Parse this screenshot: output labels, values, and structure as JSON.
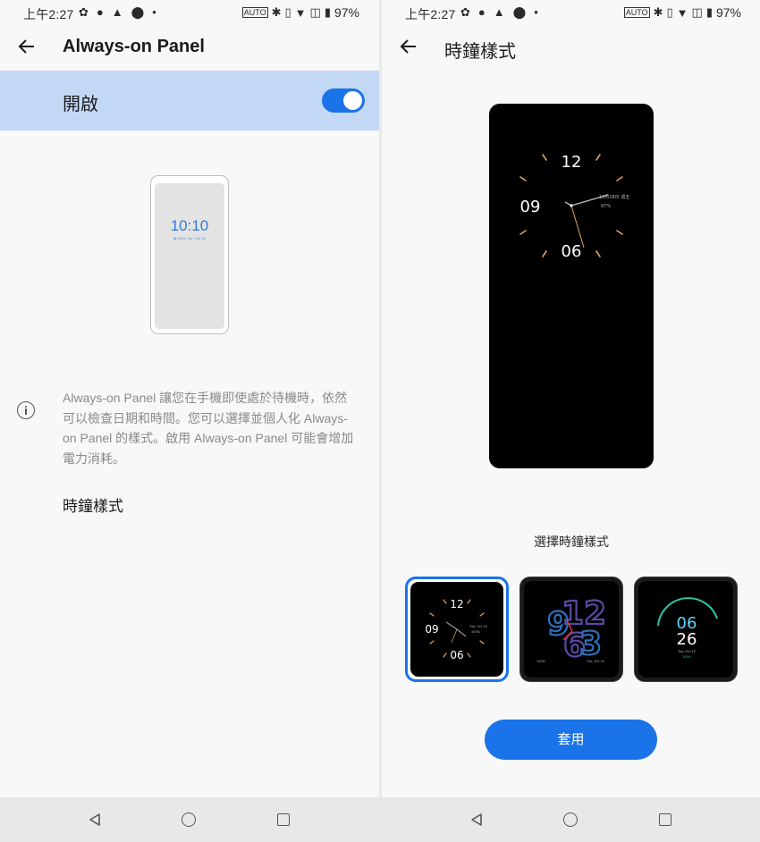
{
  "status_bar": {
    "time": "上午2:27",
    "battery": "97%",
    "left_icons": [
      "gear-icon",
      "circle-app-icon",
      "warning-icon",
      "location-icon",
      "dot-icon"
    ],
    "right_icons": [
      "auto-icon",
      "bluetooth-icon",
      "vibrate-icon",
      "wifi-icon",
      "no-sim-icon",
      "battery-icon"
    ]
  },
  "left_screen": {
    "title": "Always-on Panel",
    "toggle_label": "開啟",
    "toggle_on": true,
    "preview_time": "10:10",
    "preview_sub": "▮ 100%   Tue, Oct 15",
    "info_text": "Always-on Panel 讓您在手機即使處於待機時，依然可以檢查日期和時間。您可以選擇並個人化 Always-on Panel 的樣式。啟用 Always-on Panel 可能會增加電力消耗。",
    "clock_style_label": "時鐘樣式"
  },
  "right_screen": {
    "title": "時鐘樣式",
    "preview_clock": {
      "top": "12",
      "left": "09",
      "bottom": "06",
      "date": "10月18日 週五",
      "battery": "97%"
    },
    "choose_label": "選擇時鐘樣式",
    "thumbnails": [
      {
        "style": "analog",
        "selected": true,
        "top": "12",
        "left": "09",
        "bottom": "06",
        "date": "Tue, Oct 15",
        "battery": "100%"
      },
      {
        "style": "large-digits",
        "selected": false,
        "digits": "1296 3",
        "battery": "100%",
        "date": "Tue, Oct 15"
      },
      {
        "style": "arc-digital",
        "selected": false,
        "hour": "06",
        "minute": "26",
        "date": "Tue, Oct 15",
        "battery": "100%"
      }
    ],
    "apply_label": "套用"
  },
  "colors": {
    "accent": "#1a73e8",
    "toggle_row_bg": "#c3d8f4",
    "clock_tick": "#e3a35a"
  }
}
